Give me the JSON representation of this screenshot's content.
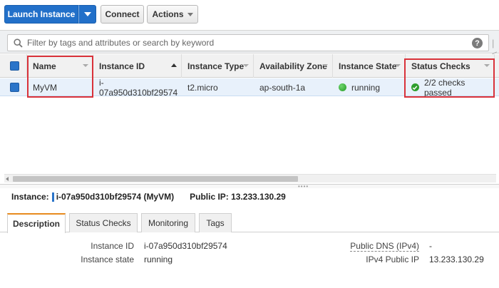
{
  "toolbar": {
    "launch_label": "Launch Instance",
    "connect_label": "Connect",
    "actions_label": "Actions"
  },
  "filter": {
    "placeholder": "Filter by tags and attributes or search by keyword",
    "help_glyph": "?",
    "pager_glyph": "|<"
  },
  "table": {
    "columns": [
      "Name",
      "Instance ID",
      "Instance Type",
      "Availability Zone",
      "Instance State",
      "Status Checks"
    ],
    "row": {
      "name": "MyVM",
      "instance_id": "i-07a950d310bf29574",
      "instance_type": "t2.micro",
      "availability_zone": "ap-south-1a",
      "instance_state": "running",
      "status_checks": "2/2 checks passed"
    }
  },
  "instance_info": {
    "label": "Instance:",
    "id": "i-07a950d310bf29574 (MyVM)",
    "public_ip": "Public IP: 13.233.130.29"
  },
  "tabs": [
    "Description",
    "Status Checks",
    "Monitoring",
    "Tags"
  ],
  "description": {
    "left": [
      {
        "label": "Instance ID",
        "value": "i-07a950d310bf29574"
      },
      {
        "label": "Instance state",
        "value": "running"
      }
    ],
    "right": [
      {
        "label": "Public DNS (IPv4)",
        "value": "-"
      },
      {
        "label": "IPv4 Public IP",
        "value": "13.233.130.29"
      }
    ]
  },
  "colors": {
    "primary_button": "#2270c9",
    "selected_row": "#e8f1fb",
    "highlight_box": "#d9323a",
    "running_green": "#239a23",
    "active_tab_accent": "#e88b1e"
  }
}
